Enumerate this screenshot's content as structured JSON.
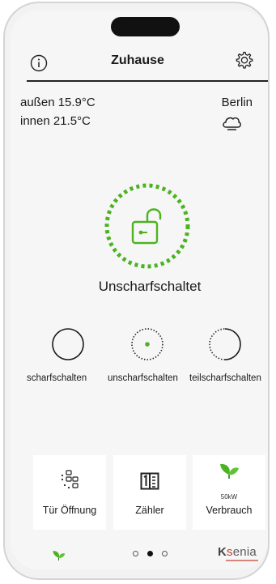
{
  "header": {
    "title": "Zuhause",
    "info_icon": "info-icon",
    "settings_icon": "gear-icon"
  },
  "weather": {
    "outside": "außen 15.9°C",
    "inside": "innen 21.5°C",
    "city": "Berlin",
    "icon": "cloud-icon"
  },
  "status": {
    "label": "Unscharfschaltet",
    "icon": "unlocked-padlock-icon"
  },
  "modes": [
    {
      "label": "scharfschalten",
      "state": "inactive"
    },
    {
      "label": "unscharfschalten",
      "state": "active"
    },
    {
      "label": "teilscharfschalten",
      "state": "inactive"
    }
  ],
  "tiles": [
    {
      "label": "Tür Öffnung",
      "value": "",
      "icon": "sensor-grid-icon"
    },
    {
      "label": "Zähler",
      "value": "",
      "icon": "meter-icon"
    },
    {
      "label": "Verbrauch",
      "value": "50kW",
      "icon": "leaf-icon"
    }
  ],
  "footer": {
    "page_count": 3,
    "active_page": 2,
    "brand": "Ksenia",
    "left_icon": "leaf-icon"
  },
  "colors": {
    "accent": "#4bb321",
    "text": "#1a1a1a",
    "brand_red": "#c8392b"
  }
}
